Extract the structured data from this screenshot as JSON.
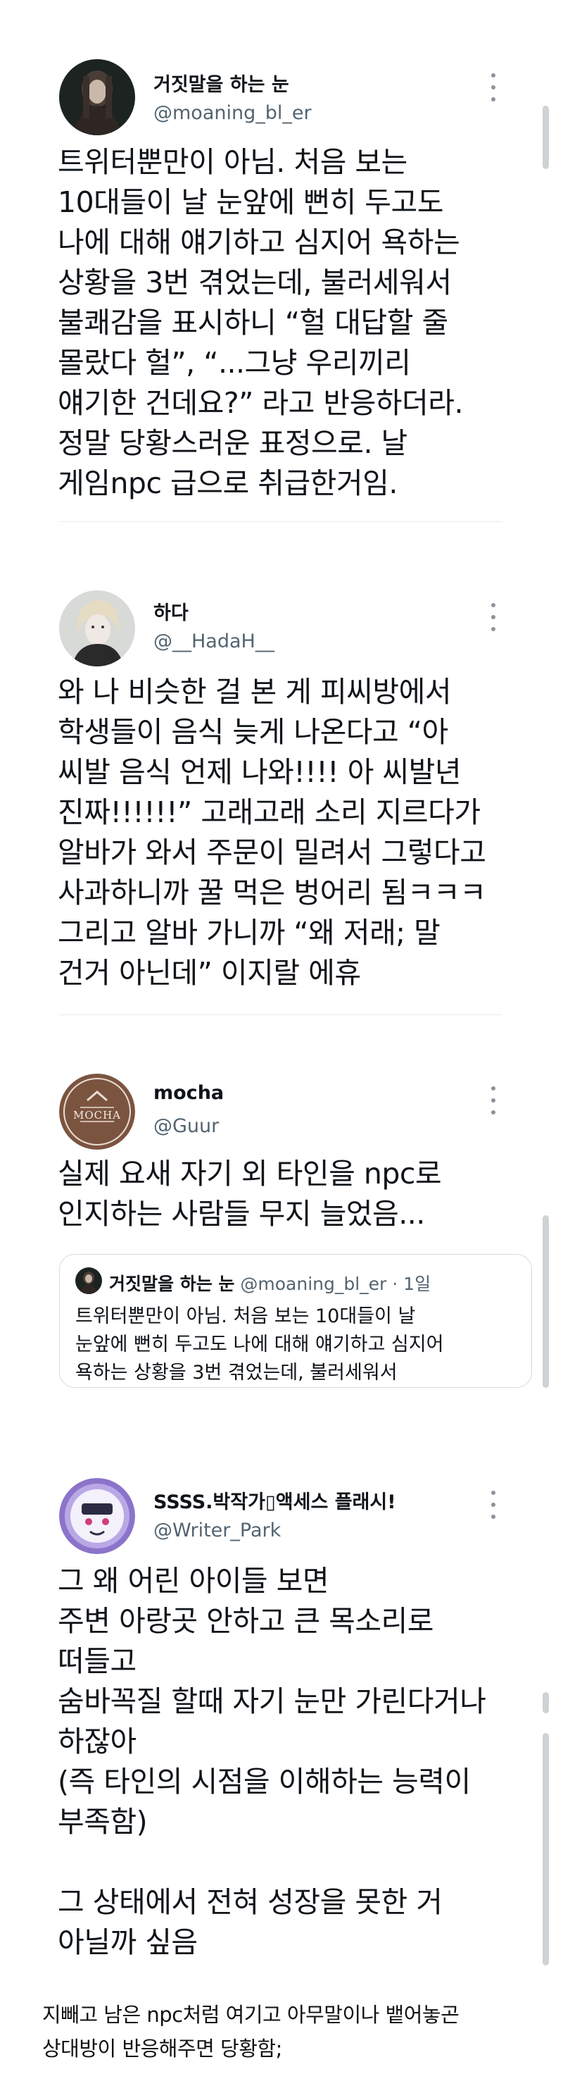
{
  "tweets": [
    {
      "name": "거짓말을 하는 눈",
      "handle": "@moaning_bl_er",
      "body": "트위터뿐만이 아님. 처음 보는\n10대들이 날 눈앞에 뻔히 두고도\n나에 대해 얘기하고 심지어 욕하는\n상황을 3번 겪었는데, 불러세워서\n불쾌감을 표시하니 “헐 대답할 줄\n몰랐다 헐”, “...그냥 우리끼리\n얘기한 건데요?” 라고 반응하더라.\n정말 당황스러운 표정으로. 날\n게임npc 급으로 취급한거임."
    },
    {
      "name": "하다",
      "handle": "@__HadaH__",
      "body": "와 나 비슷한 걸 본 게 피씨방에서\n학생들이 음식 늦게 나온다고 “아\n씨발 음식 언제 나와!!!! 아 씨발년\n진짜!!!!!!” 고래고래 소리 지르다가\n알바가 와서 주문이 밀려서 그렇다고\n사과하니까 꿀 먹은 벙어리 됨ㅋㅋㅋ\n그리고 알바 가니까 “왜 저래; 말\n건거 아닌데” 이지랄 에휴"
    },
    {
      "name": "mocha",
      "handle": "@Guur",
      "avatar_text": "MOCHA",
      "body": "실제 요새 자기 외 타인을 npc로\n인지하는 사람들 무지 늘었음...",
      "quote": {
        "name": "거짓말을 하는 눈",
        "handle": "@moaning_bl_er · 1일",
        "text": "트위터뿐만이 아님. 처음 보는 10대들이 날\n눈앞에 뻔히 두고도 나에 대해 얘기하고 심지어\n욕하는 상황을 3번 겪었는데, 불러세워서"
      }
    },
    {
      "name": "SSSS.박작가▯액세스 플래시!",
      "handle": "@Writer_Park",
      "body": "그 왜 어린 아이들 보면\n주변 아랑곳 안하고 큰 목소리로\n떠들고\n숨바꼭질 할때 자기 눈만 가린다거나\n하잖아\n(즉 타인의 시점을 이해하는 능력이\n부족함)\n\n그 상태에서 전혀 성장을 못한 거\n아닐까 싶음"
    }
  ],
  "caption": "지빼고 남은 npc처럼 여기고 아무말이나 뱉어놓곤\n상대방이 반응해주면 당황함;",
  "colors": {
    "name": "#0f1419",
    "handle": "#536471",
    "divider": "#e6ecf0",
    "mocha_brand": "#7b5440",
    "park_avatar": "#8b74c9"
  }
}
